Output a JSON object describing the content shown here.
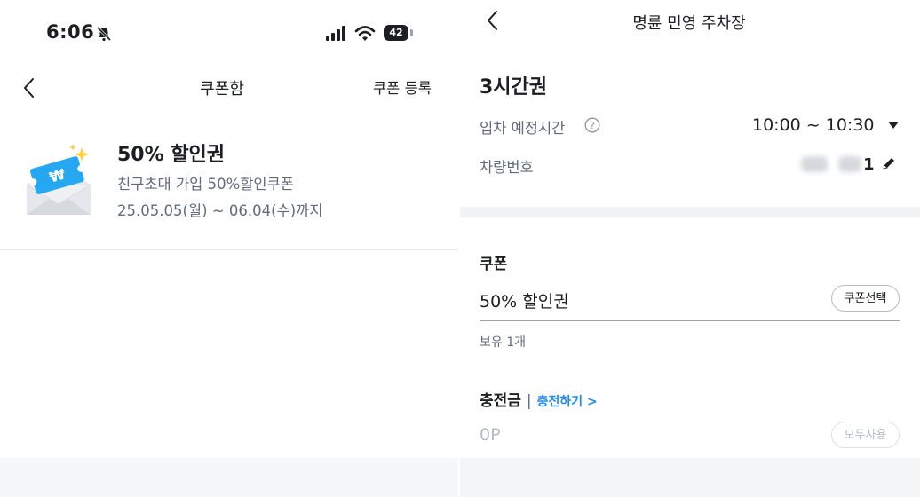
{
  "status_bar": {
    "time": "6:06",
    "battery": "42"
  },
  "left_screen": {
    "title": "쿠폰함",
    "register_label": "쿠폰 등록",
    "coupon": {
      "name": "50% 할인권",
      "description": "친구초대 가입 50%할인쿠폰",
      "period": "25.05.05(월) ~ 06.04(수)까지"
    }
  },
  "right_screen": {
    "title": "명륜 민영 주차장",
    "ticket_title": "3시간권",
    "entry_time_label": "입차 예정시간",
    "entry_time_value": "10:00 ~ 10:30",
    "plate_label": "차량번호",
    "plate_visible_digit": "1",
    "coupon_section_title": "쿠폰",
    "coupon_selected": "50% 할인권",
    "coupon_select_button": "쿠폰선택",
    "coupon_owned": "보유 1개",
    "charge_section_title": "충전금",
    "charge_separator": "|",
    "charge_link": "충전하기 >",
    "points_value": "0P",
    "use_all_button": "모두사용"
  },
  "colors": {
    "accent": "#1a8cff",
    "coupon_blue": "#25a7f2",
    "muted_text": "#5f6b7a"
  }
}
